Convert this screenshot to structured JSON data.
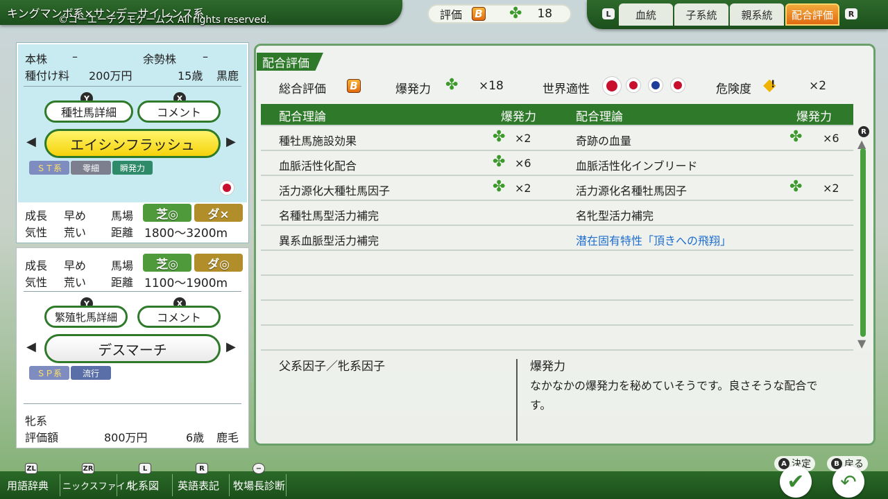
{
  "header": {
    "title": "キングマンボ系×サンデーサイレンス系",
    "copyright": "©コーエーテクモゲームス All rights reserved.",
    "rating_label": "評価",
    "rating_grade": "B",
    "rating_count": "18"
  },
  "tabs": {
    "left_button": "L",
    "right_button": "R",
    "items": [
      "血統",
      "子系統",
      "親系統",
      "配合評価"
    ],
    "active": "配合評価"
  },
  "sire": {
    "line_label": "本株",
    "line_value": "–",
    "surplus_label": "余勢株",
    "surplus_value": "–",
    "fee_label": "種付け料",
    "fee_value": "200万円",
    "age": "15歳",
    "coat": "黒鹿",
    "detail_button": "種牡馬詳細",
    "detail_key": "Y",
    "comment_button": "コメント",
    "comment_key": "X",
    "name": "エイシンフラッシュ",
    "tags": [
      "ＳＴ系",
      "零細",
      "瞬発力"
    ],
    "growth_label": "成長",
    "growth_value": "早め",
    "temper_label": "気性",
    "temper_value": "荒い",
    "track_label": "馬場",
    "turf": "芝◎",
    "dirt": "ダ×",
    "distance_label": "距離",
    "distance_value": "1800～3200m"
  },
  "dam": {
    "growth_label": "成長",
    "growth_value": "早め",
    "temper_label": "気性",
    "temper_value": "荒い",
    "track_label": "馬場",
    "turf": "芝◎",
    "dirt": "ダ◎",
    "distance_label": "距離",
    "distance_value": "1100～1900m",
    "detail_button": "繁殖牝馬詳細",
    "detail_key": "Y",
    "comment_button": "コメント",
    "comment_key": "X",
    "name": "デスマーチ",
    "tags": [
      "ＳＰ系",
      "流行"
    ],
    "line_label": "牝系",
    "value_label": "評価額",
    "value": "800万円",
    "age": "6歳",
    "coat": "鹿毛"
  },
  "main": {
    "section_title": "配合評価",
    "overall_label": "総合評価",
    "overall_grade": "B",
    "power_label": "爆発力",
    "power_value": "×18",
    "world_label": "世界適性",
    "danger_label": "危険度",
    "danger_value": "×2",
    "col_theory": "配合理論",
    "col_power": "爆発力",
    "rows_left": [
      {
        "name": "種牡馬施設効果",
        "mult": "×2"
      },
      {
        "name": "血脈活性化配合",
        "mult": "×6"
      },
      {
        "name": "活力源化大種牡馬因子",
        "mult": "×2"
      },
      {
        "name": "名種牡馬型活力補完",
        "mult": ""
      },
      {
        "name": "異系血脈型活力補完",
        "mult": ""
      }
    ],
    "rows_right": [
      {
        "name": "奇跡の血量",
        "mult": "×6"
      },
      {
        "name": "血脈活性化インブリード",
        "mult": ""
      },
      {
        "name": "活力源化名種牡馬因子",
        "mult": "×2"
      },
      {
        "name": "名牝型活力補完",
        "mult": ""
      },
      {
        "name": "潜在固有特性「頂きへの飛翔」",
        "mult": ""
      }
    ],
    "desc_left_title": "父系因子／牝系因子",
    "desc_title": "爆発力",
    "desc_line1": "なかなかの爆発力を秘めていそうです。良さそうな配合で",
    "desc_line2": "す。"
  },
  "bottom": {
    "items": [
      {
        "key": "ZL",
        "label": "用語辞典"
      },
      {
        "key": "ZR",
        "label": "ニックスファイル"
      },
      {
        "key": "L",
        "label": "牝系図"
      },
      {
        "key": "R",
        "label": "英語表記"
      },
      {
        "key": "−",
        "label": "牧場長診断"
      }
    ],
    "confirm_key": "A",
    "confirm_label": "決定",
    "back_key": "B",
    "back_label": "戻る"
  },
  "colors": {
    "accent_green": "#2f7a2a",
    "active_tab": "#e06b14",
    "link_blue": "#1f6ecf",
    "sire_panel": "#c8eaf1"
  }
}
